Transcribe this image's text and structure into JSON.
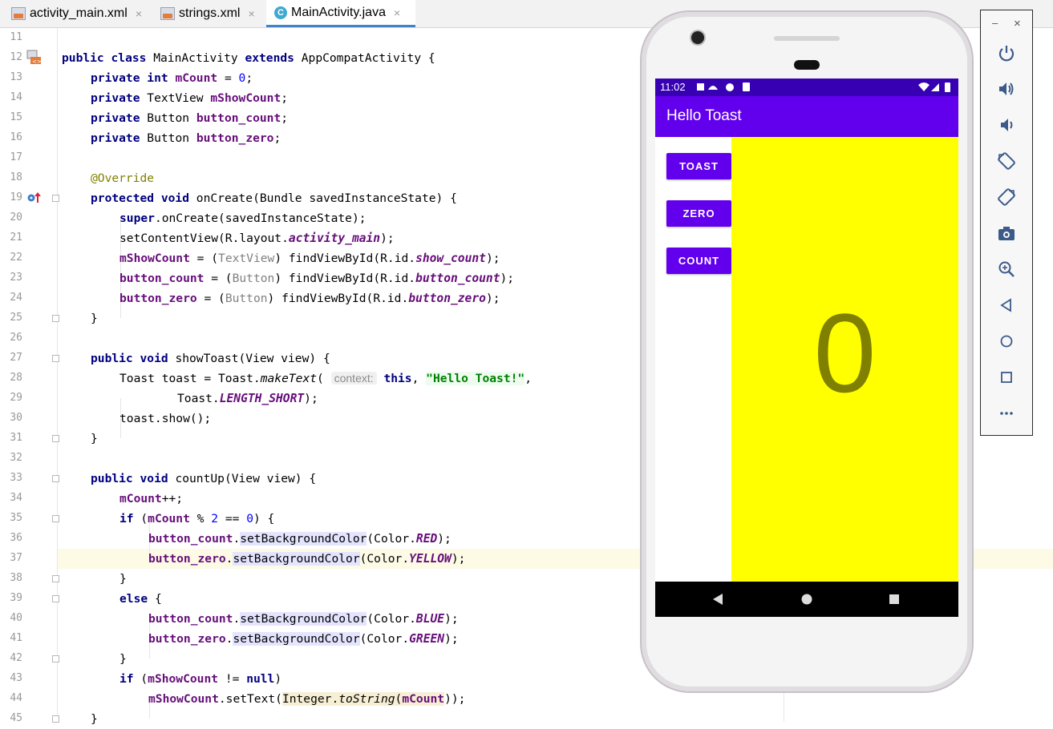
{
  "tabs": [
    {
      "label": "activity_main.xml",
      "icon": "xml-file-icon",
      "active": false
    },
    {
      "label": "strings.xml",
      "icon": "xml-file-icon",
      "active": false
    },
    {
      "label": "MainActivity.java",
      "icon": "java-class-icon",
      "active": true
    }
  ],
  "tab_close_glyph": "×",
  "line_numbers": [
    "11",
    "12",
    "13",
    "14",
    "15",
    "16",
    "17",
    "18",
    "19",
    "20",
    "21",
    "22",
    "23",
    "24",
    "25",
    "26",
    "27",
    "28",
    "29",
    "30",
    "31",
    "32",
    "33",
    "34",
    "35",
    "36",
    "37",
    "38",
    "39",
    "40",
    "41",
    "42",
    "43",
    "44",
    "45"
  ],
  "code_tokens": {
    "l12": [
      "public class",
      " MainActivity ",
      "extends",
      " AppCompatActivity {"
    ],
    "l13": [
      "private int",
      " ",
      "mCount",
      " = ",
      "0",
      ";"
    ],
    "l14": [
      "private",
      " TextView ",
      "mShowCount",
      ";"
    ],
    "l15": [
      "private",
      " Button ",
      "button_count",
      ";"
    ],
    "l16": [
      "private",
      " Button ",
      "button_zero",
      ";"
    ],
    "l18": [
      "@Override"
    ],
    "l19": [
      "protected void",
      " onCreate(Bundle savedInstanceState) {"
    ],
    "l20": [
      "super",
      ".onCreate(savedInstanceState);"
    ],
    "l21": [
      "setContentView(R.layout.",
      "activity_main",
      ");"
    ],
    "l22": [
      "mShowCount",
      " = (",
      "TextView",
      ") findViewById(R.id.",
      "show_count",
      ");"
    ],
    "l23": [
      "button_count",
      " = (",
      "Button",
      ") findViewById(R.id.",
      "button_count",
      ");"
    ],
    "l24": [
      "button_zero",
      " = (",
      "Button",
      ") findViewById(R.id.",
      "button_zero",
      ");"
    ],
    "l25": [
      "}"
    ],
    "l27": [
      "public void",
      " showToast(View view) {"
    ],
    "l28": [
      "Toast toast = Toast.",
      "makeText",
      "( ",
      "context:",
      " ",
      "this",
      ", ",
      "\"Hello Toast!\"",
      ","
    ],
    "l29": [
      "Toast.",
      "LENGTH_SHORT",
      ");"
    ],
    "l30": [
      "toast.show();"
    ],
    "l31": [
      "}"
    ],
    "l33": [
      "public void",
      " countUp(View view) {"
    ],
    "l34": [
      "mCount",
      "++;"
    ],
    "l35": [
      "if",
      " (",
      "mCount",
      " % ",
      "2",
      " == ",
      "0",
      ") {"
    ],
    "l36": [
      "button_count",
      ".",
      "setBackgroundColor",
      "(Color.",
      "RED",
      ");"
    ],
    "l37": [
      "button_zero",
      ".",
      "setBackgroundColor",
      "(Color.",
      "YELLOW",
      ");"
    ],
    "l38": [
      "}"
    ],
    "l39": [
      "else",
      " {"
    ],
    "l40": [
      "button_count",
      ".",
      "setBackgroundColor",
      "(Color.",
      "BLUE",
      ");"
    ],
    "l41": [
      "button_zero",
      ".",
      "setBackgroundColor",
      "(Color.",
      "GREEN",
      ");"
    ],
    "l42": [
      "}"
    ],
    "l43": [
      "if",
      " (",
      "mShowCount",
      " != ",
      "null",
      ")"
    ],
    "l44": [
      "mShowCount",
      ".setText(",
      "Integer.",
      "toString",
      "(",
      "mCount",
      "));"
    ],
    "l45": [
      "}"
    ]
  },
  "emulator": {
    "status_time": "11:02",
    "app_title": "Hello Toast",
    "buttons": [
      "TOAST",
      "ZERO",
      "COUNT"
    ],
    "count_value": "0",
    "colors": {
      "app_bar": "#6200ee",
      "status_bar": "#3700b3",
      "count_bg": "#ffff00",
      "count_text": "#808000"
    }
  },
  "emulator_toolbar": {
    "window_controls": [
      "–",
      "×"
    ],
    "icons": [
      "power-icon",
      "volume-up-icon",
      "volume-down-icon",
      "rotate-left-icon",
      "rotate-right-icon",
      "screenshot-icon",
      "zoom-icon",
      "back-icon",
      "home-icon",
      "overview-icon",
      "more-icon"
    ]
  }
}
